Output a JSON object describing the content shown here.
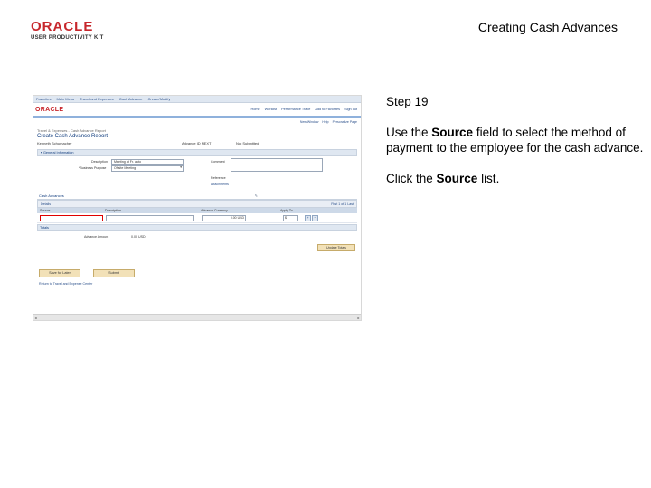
{
  "logo": {
    "brand": "ORACLE",
    "sub": "USER PRODUCTIVITY KIT"
  },
  "slide_title": "Creating Cash Advances",
  "instructions": {
    "step": "Step 19",
    "p1_pre": "Use the ",
    "p1_bold": "Source",
    "p1_post": " field to select the method of payment to the employee for the cash advance.",
    "p2_pre": "Click the ",
    "p2_bold": "Source",
    "p2_post": " list."
  },
  "app": {
    "nav": [
      "Favorites",
      "Main Menu",
      "Travel and Expenses",
      "Cash Advance",
      "Create/Modify"
    ],
    "brand": "ORACLE",
    "top_links": [
      "Home",
      "Worklist",
      "Performance Trace",
      "Add to Favorites",
      "Sign out"
    ],
    "utility": [
      "New Window",
      "Help",
      "Personalize Page"
    ],
    "breadcrumb": "Travel & Expenses - Cash Advance Report",
    "page_title": "Create Cash Advance Report",
    "employee_name": "Kenneth Schumacher",
    "employee_id": "Advance ID  NEXT",
    "status": "Not Submitted",
    "general_info_title": "General Information",
    "description_label": "Description",
    "description_value": "Meeting at Fr. auto",
    "business_purpose_label": "*Business Purpose",
    "business_purpose_value": "Offsite Meeting",
    "comment_label": "Comment",
    "reference_label": "Reference",
    "attachments_label": "Attachments",
    "advances_title": "Cash Advances",
    "grid_tab": "Details",
    "grid_nav": "First 1 of 1 Last",
    "col_source": "Source",
    "col_description": "Description",
    "col_amount": "Advance Currency",
    "col_apply": "Apply To",
    "row_amount": "0.00 USD",
    "row_currency": "$",
    "totals_title": "Totals",
    "advance_amount_label": "Advance Amount",
    "advance_amount_value": "0.00 USD",
    "update_totals_label": "Update Totals",
    "save_label": "Save for Later",
    "submit_label": "Submit",
    "return_link": "Return to Travel and Expense Center"
  }
}
